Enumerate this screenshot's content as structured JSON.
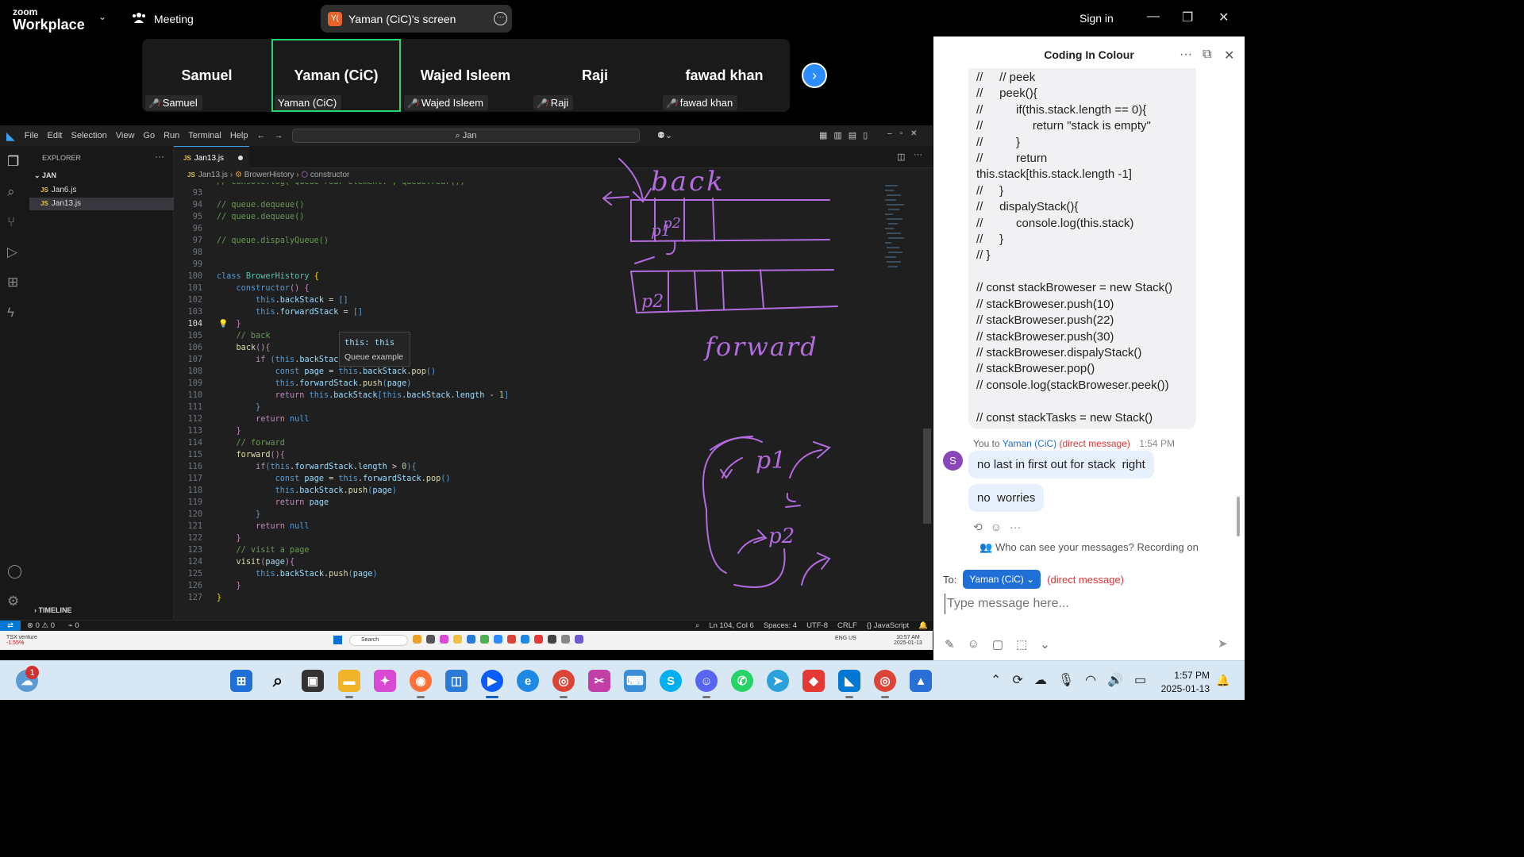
{
  "topbar": {
    "brand_small": "zoom",
    "brand_large": "Workplace",
    "meeting_label": "Meeting",
    "screen_pill_label": "Yaman (CiC)'s screen",
    "screen_pill_avatar": "Y(",
    "signin_label": "Sign in"
  },
  "gallery": {
    "participants": [
      {
        "name": "Samuel",
        "tag": "Samuel"
      },
      {
        "name": "Yaman (CiC)",
        "tag": "Yaman (CiC)"
      },
      {
        "name": "Wajed Isleem",
        "tag": "Wajed Isleem"
      },
      {
        "name": "Raji",
        "tag": "Raji"
      },
      {
        "name": "fawad khan",
        "tag": "fawad khan"
      }
    ],
    "active_index": 1
  },
  "chat": {
    "title": "Coding In Colour",
    "code_message": "//     // peek\n//     peek(){\n//          if(this.stack.length == 0){\n//               return \"stack is empty\"\n//          }\n//          return\nthis.stack[this.stack.length -1]\n//     }\n//     dispalyStack(){\n//          console.log(this.stack)\n//     }\n// }\n\n// const stackBroweser = new Stack()\n// stackBroweser.push(10)\n// stackBroweser.push(22)\n// stackBroweser.push(30)\n// stackBroweser.dispalyStack()\n// stackBroweser.pop()\n// console.log(stackBroweser.peek())\n\n// const stackTasks = new Stack()",
    "meta_you": "You to",
    "meta_to": "Yaman (CiC)",
    "meta_dm": "(direct message)",
    "meta_time": "1:54 PM",
    "avatar_letter": "S",
    "message_1": "no last in first out for stack  right",
    "message_2": "no  worries",
    "visibility_note": "Who can see your messages? Recording on",
    "to_label": "To:",
    "to_recipient": "Yaman (CiC)",
    "to_dm": "(direct message)",
    "input_placeholder": "Type message here..."
  },
  "vscode": {
    "menus": [
      "File",
      "Edit",
      "Selection",
      "View",
      "Go",
      "Run",
      "Terminal",
      "Help"
    ],
    "search_text": "Jan",
    "explorer_title": "EXPLORER",
    "folder": "JAN",
    "files": [
      "Jan6.js",
      "Jan13.js"
    ],
    "timeline": "TIMELINE",
    "tab_label": "Jan13.js",
    "breadcrumb": [
      "Jan13.js",
      "BrowerHistory",
      "constructor"
    ],
    "hover_title": "this: this",
    "hover_sub": "Queue example",
    "status": {
      "errors": "0",
      "warnings": "0",
      "ports": "0",
      "position": "Ln 104, Col 6",
      "spaces": "Spaces: 4",
      "encoding": "UTF-8",
      "eol": "CRLF",
      "language": "JavaScript"
    },
    "current_line": 104
  },
  "handwriting": {
    "back_label": "back",
    "forward_label": "forward",
    "p1": "p1",
    "p2": "p2"
  },
  "inner_taskbar": {
    "ticker_name": "TSX venture",
    "ticker_change": "-1.55%",
    "search_label": "Search",
    "lang": "ENG US",
    "time": "10:57 AM",
    "date": "2025-01-13"
  },
  "taskbar": {
    "notif_count": "1",
    "time": "1:57 PM",
    "date": "2025-01-13"
  },
  "colors": {
    "zoom_blue": "#2d8cff",
    "active_speaker": "#2bd46c",
    "pen": "#b36be0",
    "vscode_accent": "#0078d4"
  }
}
